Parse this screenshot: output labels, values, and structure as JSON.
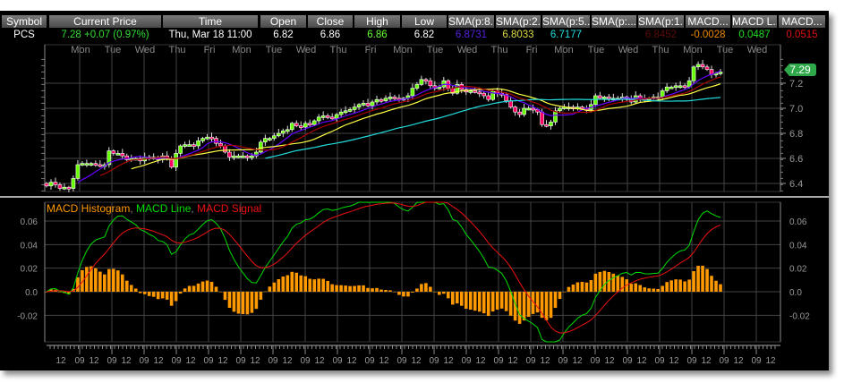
{
  "table": {
    "columns": [
      "Symbol",
      "Current Price",
      "Time",
      "Open",
      "Close",
      "High",
      "Low",
      "SMA(p:8...",
      "SMA(p:2...",
      "SMA(p:5...",
      "SMA(p:...",
      "SMA(p:1...",
      "MACD...",
      "MACD L...",
      "MACD..."
    ],
    "values": [
      "PCS",
      "7.28  +0.07 (0.97%)",
      "Thu, Mar 18  11:00",
      "6.82",
      "6.86",
      "6.86",
      "6.82",
      "6.8731",
      "6.8033",
      "6.7177",
      "",
      "6.8452",
      "-0.0028",
      "0.0487",
      "0.0515"
    ],
    "value_colors": [
      "#ffffff",
      "#33dd33",
      "#ffffff",
      "#ffffff",
      "#ffffff",
      "#66ff33",
      "#ffffff",
      "#5522dd",
      "#dddd44",
      "#22dddd",
      "#ffffff",
      "#5a0a0a",
      "#ee8800",
      "#22dd22",
      "#dd1111"
    ]
  },
  "days": [
    "Mon",
    "Tue",
    "Wed",
    "Thu",
    "Fri",
    "Mon",
    "Tue",
    "Wed",
    "Thu",
    "Fri",
    "Mon",
    "Tue",
    "Wed",
    "Thu",
    "Fri",
    "Mon",
    "Tue",
    "Wed",
    "Thu",
    "Mon",
    "Tue",
    "Wed"
  ],
  "price_tag": "7.29",
  "macd_legend": {
    "histogram": "MACD Histogram",
    "line": "MACD Line",
    "signal": "MACD Signal",
    "sep": ","
  },
  "colors": {
    "up": "#66ff00",
    "down": "#ff0066",
    "sma8": "#6600ff",
    "sma2x": "#ffff44",
    "sma5x": "#22dddd",
    "sma1x": "#aa0000",
    "histogram": "#ff9900",
    "macd_line": "#00dd00",
    "macd_signal": "#ee1111",
    "grid": "#444444"
  },
  "chart_data": [
    {
      "type": "candlestick",
      "price_ticks": [
        "7.2",
        "7.0",
        "6.8",
        "6.6",
        "6.4"
      ],
      "ylim": [
        6.32,
        7.43
      ],
      "closes": [
        6.38,
        6.41,
        6.39,
        6.36,
        6.37,
        6.36,
        6.44,
        6.55,
        6.56,
        6.56,
        6.56,
        6.55,
        6.54,
        6.55,
        6.66,
        6.64,
        6.64,
        6.62,
        6.59,
        6.6,
        6.6,
        6.58,
        6.61,
        6.6,
        6.61,
        6.59,
        6.62,
        6.6,
        6.53,
        6.64,
        6.7,
        6.71,
        6.71,
        6.7,
        6.74,
        6.76,
        6.77,
        6.76,
        6.72,
        6.7,
        6.65,
        6.61,
        6.62,
        6.62,
        6.62,
        6.61,
        6.62,
        6.65,
        6.73,
        6.76,
        6.76,
        6.78,
        6.8,
        6.82,
        6.83,
        6.88,
        6.86,
        6.85,
        6.88,
        6.87,
        6.9,
        6.93,
        6.94,
        6.93,
        6.92,
        6.95,
        6.97,
        6.98,
        6.99,
        7.01,
        7.03,
        7.04,
        7.02,
        7.05,
        7.07,
        7.06,
        7.08,
        7.09,
        7.08,
        7.07,
        7.08,
        7.1,
        7.16,
        7.19,
        7.23,
        7.22,
        7.18,
        7.16,
        7.17,
        7.22,
        7.16,
        7.12,
        7.19,
        7.15,
        7.13,
        7.14,
        7.13,
        7.12,
        7.1,
        7.07,
        7.14,
        7.12,
        7.11,
        7.06,
        7.01,
        6.97,
        6.95,
        7.0,
        7.0,
        6.99,
        6.97,
        6.87,
        6.86,
        6.89,
        6.98,
        7.0,
        7.01,
        7.01,
        7.0,
        7.01,
        7.0,
        6.99,
        7.03,
        7.1,
        7.08,
        7.09,
        7.08,
        7.08,
        7.08,
        7.09,
        7.08,
        7.05,
        7.1,
        7.08,
        7.07,
        7.08,
        7.09,
        7.09,
        7.14,
        7.17,
        7.17,
        7.18,
        7.18,
        7.17,
        7.22,
        7.33,
        7.35,
        7.33,
        7.31,
        7.27,
        7.28,
        7.29
      ],
      "sma_periods": [
        8,
        20,
        50,
        13
      ]
    },
    {
      "type": "macd",
      "ticks": [
        "0.06",
        "0.04",
        "0.02",
        "0.0",
        "-0.02"
      ],
      "ylim": [
        -0.042,
        0.075
      ]
    }
  ],
  "time_axis": {
    "first": "12",
    "pair": [
      "09",
      "12"
    ]
  }
}
